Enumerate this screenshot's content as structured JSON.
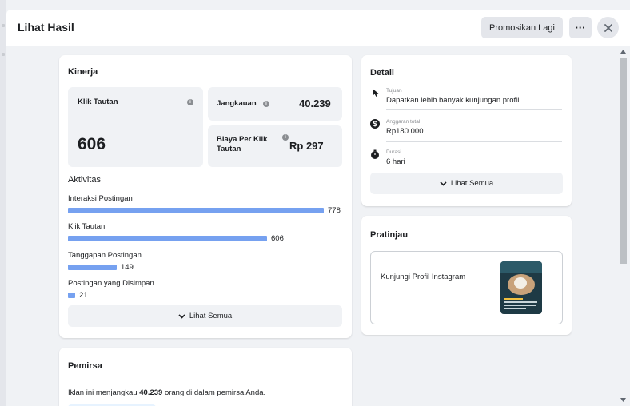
{
  "header": {
    "title": "Lihat Hasil",
    "promote_label": "Promosikan Lagi",
    "more_label": "···"
  },
  "performance": {
    "title": "Kinerja",
    "link_clicks": {
      "label": "Klik Tautan",
      "value": "606"
    },
    "reach": {
      "label": "Jangkauan",
      "value": "40.239"
    },
    "cpc": {
      "label": "Biaya Per Klik Tautan",
      "value": "Rp 297"
    },
    "info_glyph": "i"
  },
  "activity": {
    "title": "Aktivitas",
    "items": [
      {
        "label": "Interaksi Postingan",
        "value": "778",
        "amount": 778
      },
      {
        "label": "Klik Tautan",
        "value": "606",
        "amount": 606
      },
      {
        "label": "Tanggapan Postingan",
        "value": "149",
        "amount": 149
      },
      {
        "label": "Postingan yang Disimpan",
        "value": "21",
        "amount": 21
      }
    ],
    "see_all": "Lihat Semua"
  },
  "audience": {
    "title": "Pemirsa",
    "text_before": "Iklan ini menjangkau ",
    "reach_bold": "40.239",
    "text_after": " orang di dalam pemirsa Anda."
  },
  "detail": {
    "title": "Detail",
    "items": [
      {
        "small": "Tujuan",
        "value": "Dapatkan lebih banyak kunjungan profil",
        "icon": "cursor-icon"
      },
      {
        "small": "Anggaran total",
        "value": "Rp180.000",
        "icon": "dollar-icon"
      },
      {
        "small": "Durasi",
        "value": "6 hari",
        "icon": "stopwatch-icon"
      }
    ],
    "see_all": "Lihat Semua"
  },
  "preview": {
    "title": "Pratinjau",
    "cta": "Kunjungi Profil Instagram"
  },
  "colors": {
    "bar": "#76a1f0",
    "background": "#f0f2f5",
    "card": "#ffffff"
  }
}
